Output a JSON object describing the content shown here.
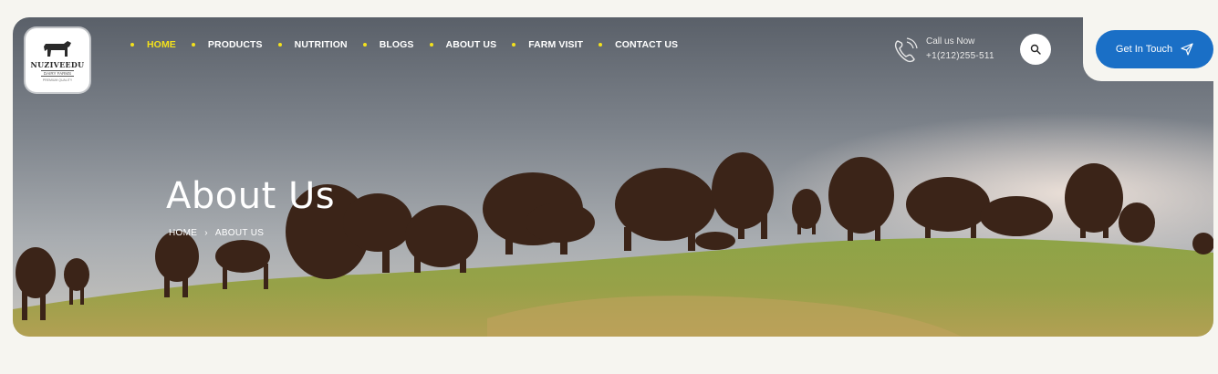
{
  "logo": {
    "brand": "NUZIVEEDU",
    "sub": "DAIRY FARMS",
    "tiny": "PREMIUM QUALITY"
  },
  "nav": {
    "items": [
      {
        "label": "HOME",
        "active": true
      },
      {
        "label": "PRODUCTS"
      },
      {
        "label": "NUTRITION"
      },
      {
        "label": "BLOGS"
      },
      {
        "label": "ABOUT US"
      },
      {
        "label": "FARM VISIT"
      },
      {
        "label": "CONTACT US"
      }
    ]
  },
  "contact": {
    "title": "Call us Now",
    "number": "+1(212)255-511"
  },
  "cta": {
    "label": "Get In Touch"
  },
  "hero": {
    "title": "About Us",
    "breadcrumb": {
      "home": "HOME",
      "separator": "›",
      "current": "ABOUT US"
    }
  },
  "colors": {
    "accent": "#f3e11c",
    "cta": "#1a6fc6",
    "background": "#f6f5f0"
  },
  "icons": {
    "phone": "phone-icon",
    "search": "search-icon",
    "send": "paper-plane-icon"
  }
}
